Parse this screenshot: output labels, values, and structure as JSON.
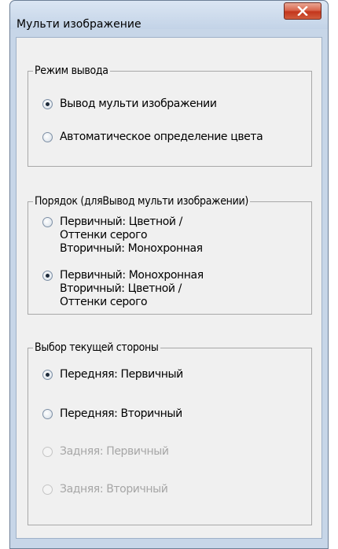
{
  "window": {
    "title": "Мульти изображение",
    "close_glyph": "X"
  },
  "output_mode": {
    "legend": "Режим вывода",
    "options": [
      {
        "label": "Вывод мульти изображении",
        "checked": true,
        "enabled": true
      },
      {
        "label": "Автоматическое определение цвета",
        "checked": false,
        "enabled": true
      }
    ]
  },
  "order": {
    "legend": "Порядок (дляВывод мульти изображении)",
    "options": [
      {
        "lines": [
          "Первичный: Цветной /",
          "Оттенки серого",
          "Вторичный: Монохронная"
        ],
        "checked": false,
        "enabled": true
      },
      {
        "lines": [
          "Первичный: Монохронная",
          "Вторичный: Цветной /",
          "Оттенки серого"
        ],
        "checked": true,
        "enabled": true
      }
    ]
  },
  "side": {
    "legend": "Выбор текущей стороны",
    "options": [
      {
        "label": "Передняя: Первичный",
        "checked": true,
        "enabled": true
      },
      {
        "label": "Передняя: Вторичный",
        "checked": false,
        "enabled": true
      },
      {
        "label": "Задняя: Первичный",
        "checked": false,
        "enabled": false
      },
      {
        "label": "Задняя: Вторичный",
        "checked": false,
        "enabled": false
      }
    ]
  }
}
